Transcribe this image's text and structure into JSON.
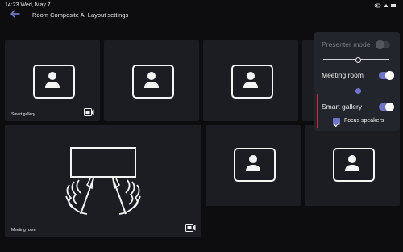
{
  "status_bar": {
    "time": "14:23 Wed, May 7"
  },
  "header": {
    "title": "Room Composite AI Layout settings"
  },
  "tiles": {
    "smart_gallery_label": "Smart gallery",
    "meeting_room_label": "Meeting room"
  },
  "panel": {
    "presenter_mode": {
      "label": "Presenter mode",
      "enabled": false
    },
    "meeting_room": {
      "label": "Meeting room",
      "enabled": true
    },
    "smart_gallery": {
      "label": "Smart gallery",
      "enabled": true
    },
    "focus_speakers": {
      "label": "Focus speakers",
      "checked": true
    }
  },
  "colors": {
    "accent": "#6f74c8",
    "highlight": "#d6252c",
    "tile": "#1b1d23",
    "panel": "#22252c"
  }
}
